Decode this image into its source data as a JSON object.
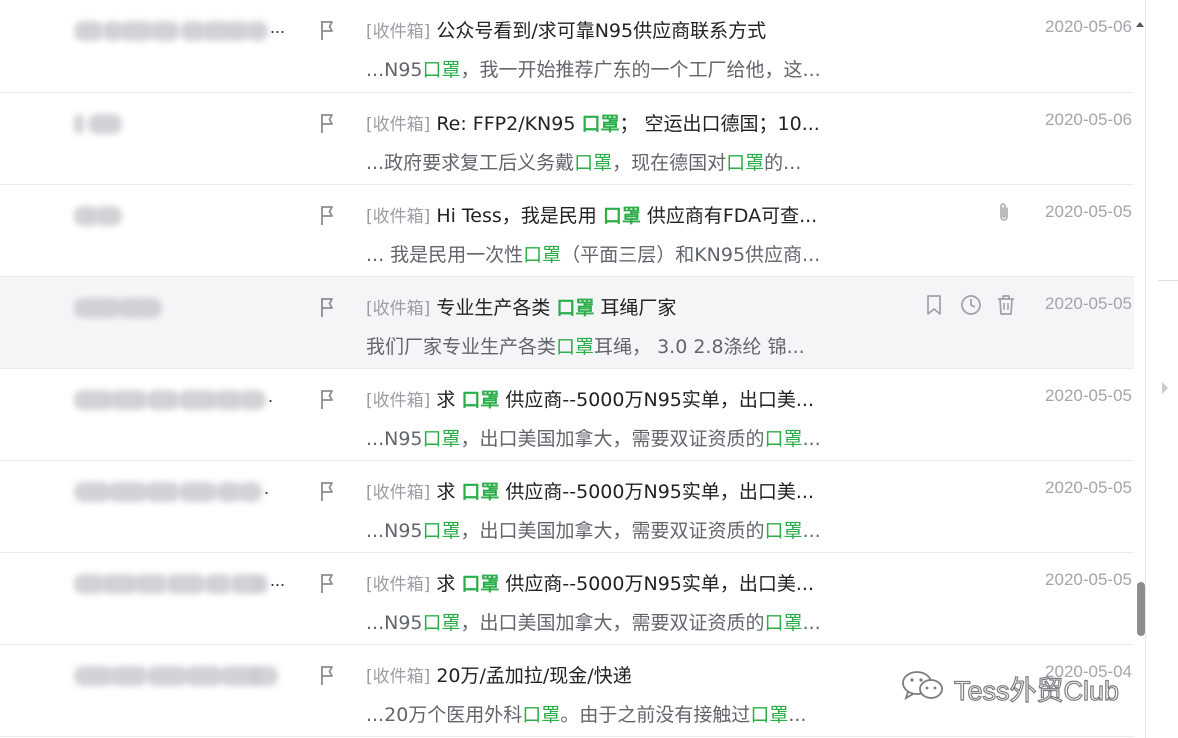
{
  "emails": [
    {
      "sender_suffix": "...",
      "folder": "[收件箱]",
      "subject": [
        {
          "text": "公众号看到/求可靠N95供应商联系方式",
          "kw": false
        }
      ],
      "preview": [
        {
          "text": "...N95",
          "kw": false
        },
        {
          "text": "口罩",
          "kw": true
        },
        {
          "text": "，我一开始推荐广东的一个工厂给他，这...",
          "kw": false
        }
      ],
      "date": "2020-05-06"
    },
    {
      "sender_suffix": "",
      "folder": "[收件箱]",
      "subject": [
        {
          "text": "Re: FFP2/KN95 ",
          "kw": false
        },
        {
          "text": "口罩",
          "kw": true
        },
        {
          "text": "； 空运出口德国；10...",
          "kw": false
        }
      ],
      "preview": [
        {
          "text": "...政府要求复工后义务戴",
          "kw": false
        },
        {
          "text": "口罩",
          "kw": true
        },
        {
          "text": "，现在德国对",
          "kw": false
        },
        {
          "text": "口罩",
          "kw": true
        },
        {
          "text": "的...",
          "kw": false
        }
      ],
      "date": "2020-05-06"
    },
    {
      "sender_suffix": "",
      "folder": "[收件箱]",
      "subject": [
        {
          "text": "Hi Tess，我是民用 ",
          "kw": false
        },
        {
          "text": "口罩",
          "kw": true
        },
        {
          "text": " 供应商有FDA可查...",
          "kw": false
        }
      ],
      "preview": [
        {
          "text": "... 我是民用一次性",
          "kw": false
        },
        {
          "text": "口罩",
          "kw": true
        },
        {
          "text": "（平面三层）和KN95供应商...",
          "kw": false
        }
      ],
      "date": "2020-05-05"
    },
    {
      "sender_suffix": "",
      "folder": "[收件箱]",
      "subject": [
        {
          "text": "专业生产各类 ",
          "kw": false
        },
        {
          "text": "口罩",
          "kw": true
        },
        {
          "text": " 耳绳厂家",
          "kw": false
        }
      ],
      "preview": [
        {
          "text": "我们厂家专业生产各类",
          "kw": false
        },
        {
          "text": "口罩",
          "kw": true
        },
        {
          "text": "耳绳， 3.0 2.8涤纶 锦...",
          "kw": false
        }
      ],
      "date": "2020-05-05"
    },
    {
      "sender_suffix": ".",
      "folder": "[收件箱]",
      "subject": [
        {
          "text": "求 ",
          "kw": false
        },
        {
          "text": "口罩",
          "kw": true
        },
        {
          "text": " 供应商--5000万N95实单，出口美...",
          "kw": false
        }
      ],
      "preview": [
        {
          "text": "...N95",
          "kw": false
        },
        {
          "text": "口罩",
          "kw": true
        },
        {
          "text": "，出口美国加拿大，需要双证资质的",
          "kw": false
        },
        {
          "text": "口罩",
          "kw": true
        },
        {
          "text": "...",
          "kw": false
        }
      ],
      "date": "2020-05-05"
    },
    {
      "sender_suffix": ".",
      "folder": "[收件箱]",
      "subject": [
        {
          "text": "求 ",
          "kw": false
        },
        {
          "text": "口罩",
          "kw": true
        },
        {
          "text": " 供应商--5000万N95实单，出口美...",
          "kw": false
        }
      ],
      "preview": [
        {
          "text": "...N95",
          "kw": false
        },
        {
          "text": "口罩",
          "kw": true
        },
        {
          "text": "，出口美国加拿大，需要双证资质的",
          "kw": false
        },
        {
          "text": "口罩",
          "kw": true
        },
        {
          "text": "...",
          "kw": false
        }
      ],
      "date": "2020-05-05"
    },
    {
      "sender_suffix": "...",
      "folder": "[收件箱]",
      "subject": [
        {
          "text": "求 ",
          "kw": false
        },
        {
          "text": "口罩",
          "kw": true
        },
        {
          "text": " 供应商--5000万N95实单，出口美...",
          "kw": false
        }
      ],
      "preview": [
        {
          "text": "...N95",
          "kw": false
        },
        {
          "text": "口罩",
          "kw": true
        },
        {
          "text": "，出口美国加拿大，需要双证资质的",
          "kw": false
        },
        {
          "text": "口罩",
          "kw": true
        },
        {
          "text": "...",
          "kw": false
        }
      ],
      "date": "2020-05-05"
    },
    {
      "sender_suffix": "",
      "folder": "[收件箱]",
      "subject": [
        {
          "text": "20万/孟加拉/现金/快递",
          "kw": false
        }
      ],
      "preview": [
        {
          "text": "...20万个医用外科",
          "kw": false
        },
        {
          "text": "口罩",
          "kw": true
        },
        {
          "text": "。由于之前没有接触过",
          "kw": false
        },
        {
          "text": "口罩",
          "kw": true
        },
        {
          "text": "...",
          "kw": false
        }
      ],
      "date": "2020-05-04"
    }
  ],
  "hovered_row": 3,
  "attachment_row": 2,
  "row_actions": [
    "bookmark-icon",
    "clock-icon",
    "trash-icon"
  ],
  "watermark": {
    "icon": "wechat-icon",
    "text": "Tess外贸Club"
  },
  "colors": {
    "keyword": "#2bae4a",
    "folder": "#9a9da2",
    "date": "#a2a5aa",
    "hover_bg": "#f4f5f6"
  }
}
